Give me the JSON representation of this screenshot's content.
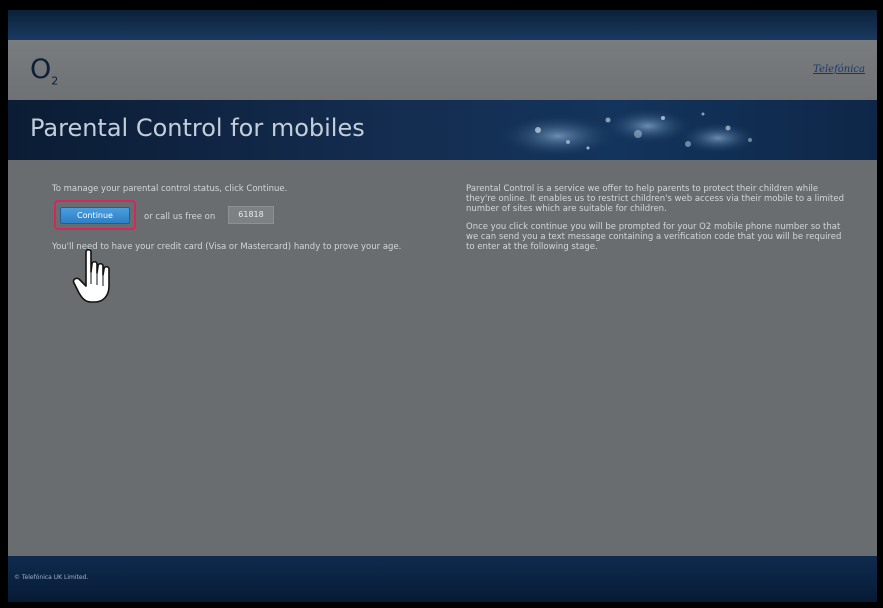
{
  "header": {
    "brand_main": "O",
    "brand_sub": "2",
    "partner_logo": "Telefónica"
  },
  "banner": {
    "title": "Parental Control for mobiles"
  },
  "left": {
    "intro": "To manage your parental control status, click Continue.",
    "continue_label": "Continue",
    "call_text": "or call us free on",
    "phone_number": "61818",
    "credit_note": "You'll need to have your credit card (Visa or Mastercard) handy to prove your age."
  },
  "right": {
    "paragraph_1": "Parental Control is a service we offer to help parents to protect their children while they're online. It enables us to restrict children's web access via their mobile to a limited number of sites which are suitable for children.",
    "paragraph_2": "Once you click continue you will be prompted for your O2 mobile phone number so that we can send you a text message containing a verification code that you will be required to enter at the following stage."
  },
  "footer": {
    "copyright": "© Telefónica UK Limited."
  },
  "colors": {
    "accent_button": "#3a8fd4",
    "highlight": "#d12a5a",
    "banner_dark": "#0b1c34",
    "content_bg": "#6a6d6f"
  },
  "icons": {
    "cursor": "hand-pointer-icon"
  }
}
